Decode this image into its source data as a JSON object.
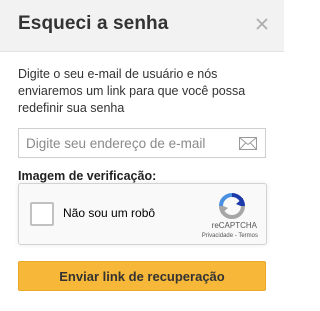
{
  "header": {
    "title": "Esqueci a senha",
    "close_icon": "close-icon"
  },
  "instructions": "Digite o seu e-mail de usuário e nós enviaremos um link para que você possa redefinir sua senha",
  "email": {
    "value": "",
    "placeholder": "Digite seu endereço de e-mail",
    "icon": "mail-icon"
  },
  "captcha": {
    "label": "Imagem de verificação:",
    "checkbox_label": "Não sou um robô",
    "checked": false,
    "brand": "reCAPTCHA",
    "privacy": "Privacidade",
    "separator": " - ",
    "terms": "Termos",
    "logo_icon": "recaptcha-logo-icon"
  },
  "submit": {
    "label": "Enviar link de recuperação",
    "color": "#f7b738"
  },
  "colors": {
    "header_bg": "#f2f2f2",
    "accent": "#f7b738"
  }
}
